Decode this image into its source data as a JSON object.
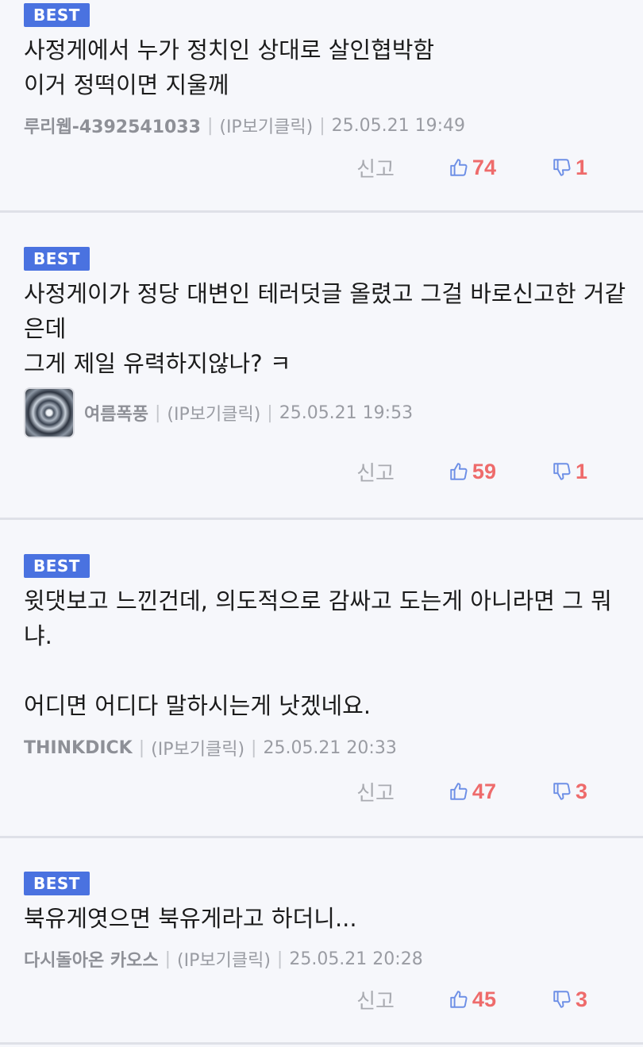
{
  "comments": [
    {
      "badge": "BEST",
      "text": "사정게에서 누가 정치인 상대로 살인협박함\n이거 정떡이면 지울께",
      "author": "루리웹-4392541033",
      "ip": "(IP보기클릭)",
      "datetime": "25.05.21 19:49",
      "report": "신고",
      "likes": "74",
      "dislikes": "1",
      "has_avatar": false
    },
    {
      "badge": "BEST",
      "text": "사정게이가 정당 대변인 테러덧글 올렸고 그걸 바로신고한 거같은데\n그게 제일 유력하지않나? ㅋ",
      "author": "여름폭풍",
      "ip": "(IP보기클릭)",
      "datetime": "25.05.21 19:53",
      "report": "신고",
      "likes": "59",
      "dislikes": "1",
      "has_avatar": true
    },
    {
      "badge": "BEST",
      "text": "윗댓보고 느낀건데, 의도적으로 감싸고 도는게 아니라면 그 뭐냐.\n\n어디면 어디다 말하시는게 낫겠네요.",
      "author": "THINKDICK",
      "ip": "(IP보기클릭)",
      "datetime": "25.05.21 20:33",
      "report": "신고",
      "likes": "47",
      "dislikes": "3",
      "has_avatar": false
    },
    {
      "badge": "BEST",
      "text": "북유게엿으면 북유게라고 하더니...",
      "author": "다시돌아온 카오스",
      "ip": "(IP보기클릭)",
      "datetime": "25.05.21 20:28",
      "report": "신고",
      "likes": "45",
      "dislikes": "3",
      "has_avatar": false
    }
  ],
  "colors": {
    "badge": "#4a72e0",
    "vote_count": "#ee6b6b",
    "thumb_icon": "#6d8fe6",
    "background": "#f6f7fb"
  }
}
